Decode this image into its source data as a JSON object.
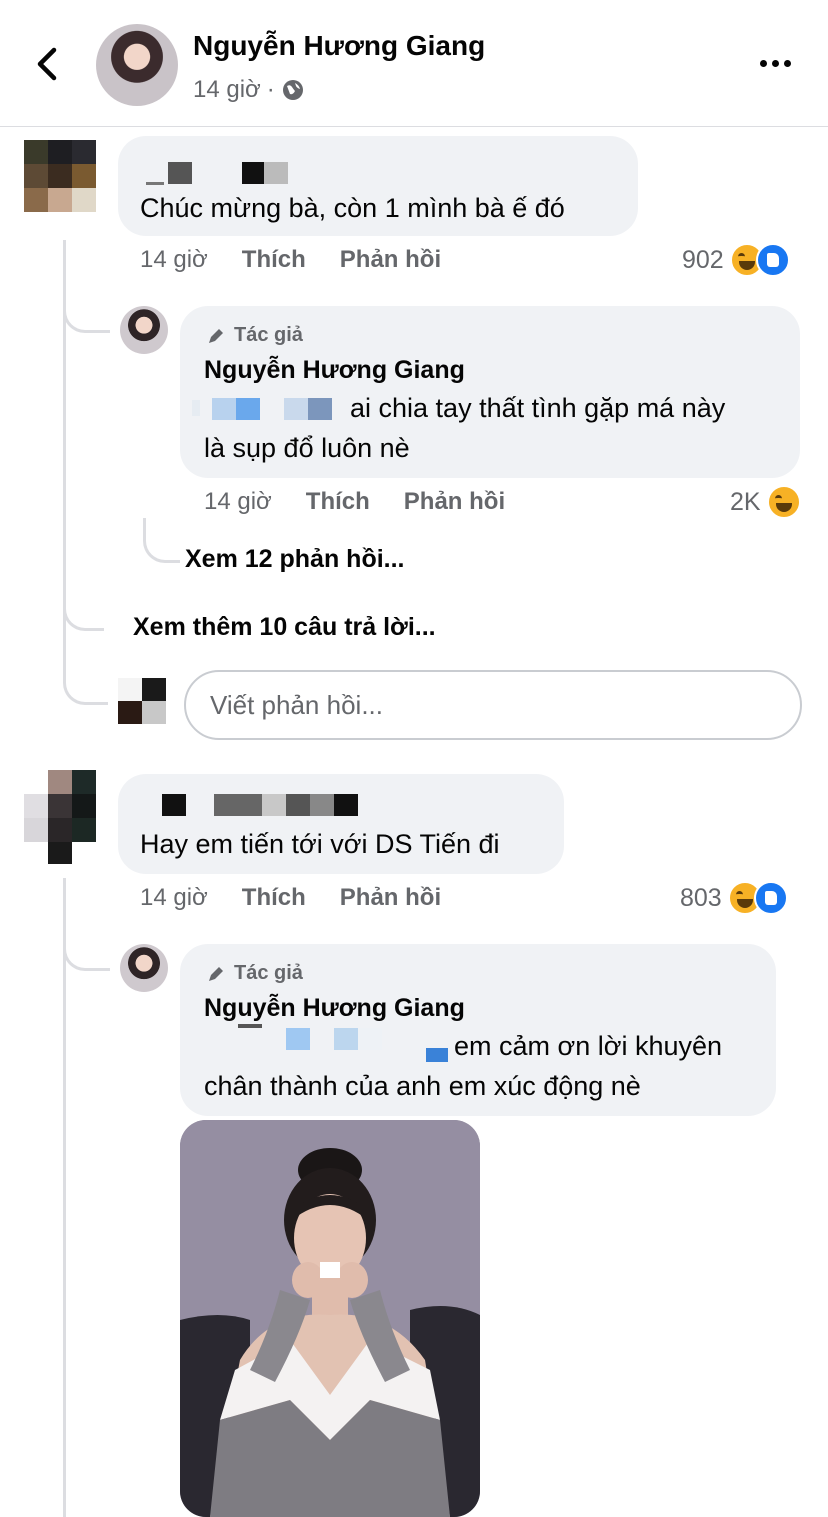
{
  "header": {
    "name": "Nguyễn Hương Giang",
    "time": "14 giờ",
    "separator": "·",
    "back_icon": "chevron-left-icon",
    "privacy_icon": "globe-icon",
    "more_icon": "more-dots-icon"
  },
  "comments": [
    {
      "text": "Chúc mừng bà, còn 1 mình bà ế đó",
      "time": "14 giờ",
      "like_label": "Thích",
      "reply_label": "Phản hồi",
      "reaction_count": "902",
      "reply": {
        "badge": "Tác giả",
        "name": "Nguyễn Hương Giang",
        "text_line1": "ai chia tay thất tình gặp má này",
        "text_line2": "là sụp đổ luôn nè",
        "time": "14 giờ",
        "like_label": "Thích",
        "reply_label": "Phản hồi",
        "reaction_count": "2K"
      },
      "view_replies": "Xem 12 phản hồi...",
      "view_more": "Xem thêm 10 câu trả lời...",
      "input_placeholder": "Viết phản hồi..."
    },
    {
      "text": "Hay em tiến tới với DS Tiến đi",
      "time": "14 giờ",
      "like_label": "Thích",
      "reply_label": "Phản hồi",
      "reaction_count": "803",
      "reply": {
        "badge": "Tác giả",
        "name": "Nguyễn Hương Giang",
        "text_line1": "em cảm ơn lời khuyên",
        "text_line2": "chân thành của anh em xúc động nè"
      }
    }
  ],
  "colors": {
    "bubble": "#f0f2f5",
    "meta": "#65676b",
    "like_blue": "#1877f2",
    "haha_yellow": "#f7b125"
  }
}
